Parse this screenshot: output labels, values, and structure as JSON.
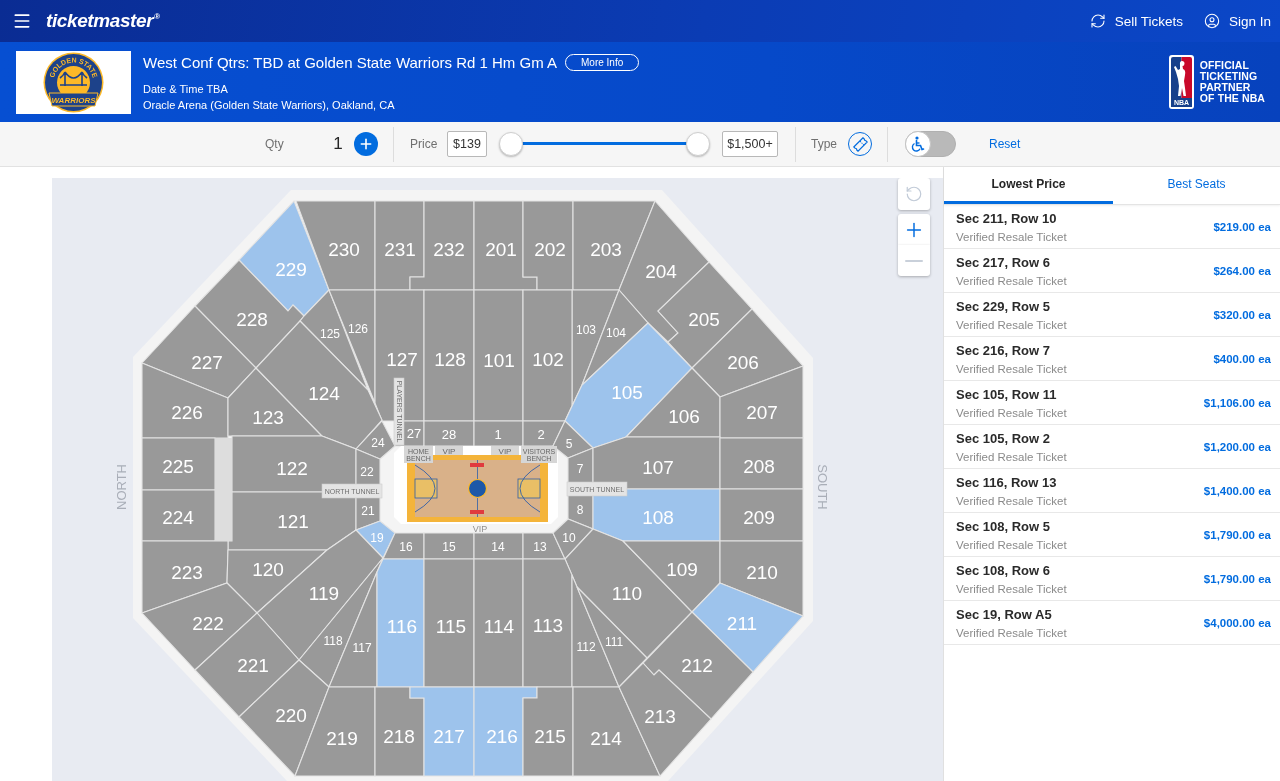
{
  "header": {
    "logo": "ticketmaster",
    "logo_mark": "®",
    "links": [
      {
        "kind": "sell",
        "label": "Sell Tickets"
      },
      {
        "kind": "account",
        "label": "Sign In"
      }
    ]
  },
  "event": {
    "team_logo": {
      "top_text": "GOLDEN STATE",
      "bottom_text": "WARRIORS"
    },
    "title": "West Conf Qtrs: TBD at Golden State Warriors Rd 1 Hm Gm A",
    "more_info": "More Info",
    "date": "Date & Time TBA",
    "venue": "Oracle Arena (Golden State Warriors), Oakland, CA",
    "partner": {
      "logo_text": "NBA",
      "lines": [
        "OFFICIAL",
        "TICKETING",
        "PARTNER",
        "OF THE NBA"
      ]
    }
  },
  "filters": {
    "quantity": {
      "label": "Qty",
      "value": "1"
    },
    "price": {
      "label": "Price",
      "min": "$139",
      "max": "$1,500+",
      "low": {
        "level": 0
      },
      "high": {
        "level": 1
      }
    },
    "type": {
      "label": "Type"
    },
    "accessible": {
      "on": false
    },
    "reset": "Reset"
  },
  "map": {
    "compass": {
      "north": "NORTH",
      "south": "SOUTH"
    },
    "tunnels": {
      "north": "NORTH TUNNEL",
      "south": "SOUTH TUNNEL",
      "players": "PLAYERS TUNNEL"
    },
    "courtside_labels": [
      "HOME BENCH",
      "VIP",
      "VIP",
      "VISITORS BENCH"
    ],
    "baseline_label": "VIP",
    "sections": [
      {
        "label": "229",
        "available": true
      },
      {
        "label": "230",
        "available": false
      },
      {
        "label": "231",
        "available": false
      },
      {
        "label": "232",
        "available": false
      },
      {
        "label": "201",
        "available": false
      },
      {
        "label": "202",
        "available": false
      },
      {
        "label": "203",
        "available": false
      },
      {
        "label": "204",
        "available": false
      },
      {
        "label": "228",
        "available": false
      },
      {
        "label": "125",
        "available": false
      },
      {
        "label": "126",
        "available": false
      },
      {
        "label": "103",
        "available": false
      },
      {
        "label": "104",
        "available": false
      },
      {
        "label": "205",
        "available": false
      },
      {
        "label": "227",
        "available": false
      },
      {
        "label": "127",
        "available": false
      },
      {
        "label": "128",
        "available": false
      },
      {
        "label": "101",
        "available": false
      },
      {
        "label": "102",
        "available": false
      },
      {
        "label": "206",
        "available": false
      },
      {
        "label": "226",
        "available": false
      },
      {
        "label": "123",
        "available": false
      },
      {
        "label": "124",
        "available": false
      },
      {
        "label": "105",
        "available": true
      },
      {
        "label": "106",
        "available": false
      },
      {
        "label": "207",
        "available": false
      },
      {
        "label": "24",
        "available": false
      },
      {
        "label": "27",
        "available": false
      },
      {
        "label": "28",
        "available": false
      },
      {
        "label": "1",
        "available": false
      },
      {
        "label": "2",
        "available": false
      },
      {
        "label": "5",
        "available": false
      },
      {
        "label": "225",
        "available": false
      },
      {
        "label": "122",
        "available": false
      },
      {
        "label": "22",
        "available": false
      },
      {
        "label": "7",
        "available": false
      },
      {
        "label": "107",
        "available": false
      },
      {
        "label": "208",
        "available": false
      },
      {
        "label": "224",
        "available": false
      },
      {
        "label": "121",
        "available": false
      },
      {
        "label": "21",
        "available": false
      },
      {
        "label": "8",
        "available": false
      },
      {
        "label": "108",
        "available": true
      },
      {
        "label": "209",
        "available": false
      },
      {
        "label": "19",
        "available": true
      },
      {
        "label": "16",
        "available": false
      },
      {
        "label": "15",
        "available": false
      },
      {
        "label": "14",
        "available": false
      },
      {
        "label": "13",
        "available": false
      },
      {
        "label": "10",
        "available": false
      },
      {
        "label": "223",
        "available": false
      },
      {
        "label": "120",
        "available": false
      },
      {
        "label": "119",
        "available": false
      },
      {
        "label": "110",
        "available": false
      },
      {
        "label": "109",
        "available": false
      },
      {
        "label": "210",
        "available": false
      },
      {
        "label": "222",
        "available": false
      },
      {
        "label": "118",
        "available": false
      },
      {
        "label": "117",
        "available": false
      },
      {
        "label": "116",
        "available": true
      },
      {
        "label": "115",
        "available": false
      },
      {
        "label": "114",
        "available": false
      },
      {
        "label": "113",
        "available": false
      },
      {
        "label": "112",
        "available": false
      },
      {
        "label": "111",
        "available": false
      },
      {
        "label": "211",
        "available": true
      },
      {
        "label": "221",
        "available": false
      },
      {
        "label": "212",
        "available": false
      },
      {
        "label": "220",
        "available": false
      },
      {
        "label": "219",
        "available": false
      },
      {
        "label": "218",
        "available": false
      },
      {
        "label": "217",
        "available": true
      },
      {
        "label": "216",
        "available": true
      },
      {
        "label": "215",
        "available": false
      },
      {
        "label": "214",
        "available": false
      },
      {
        "label": "213",
        "available": false
      }
    ],
    "controls": {
      "reset_view": {
        "disabled": true
      },
      "zoom_in": {
        "disabled": false
      },
      "zoom_out": {
        "disabled": true
      }
    }
  },
  "sidebar": {
    "tabs": [
      {
        "label": "Lowest Price",
        "selected": true
      },
      {
        "label": "Best Seats",
        "selected": false
      }
    ],
    "listings": [
      {
        "title": "Sec 211, Row 10",
        "subtitle": "Verified Resale Ticket",
        "price": "$219.00 ea"
      },
      {
        "title": "Sec 217, Row 6",
        "subtitle": "Verified Resale Ticket",
        "price": "$264.00 ea"
      },
      {
        "title": "Sec 229, Row 5",
        "subtitle": "Verified Resale Ticket",
        "price": "$320.00 ea"
      },
      {
        "title": "Sec 216, Row 7",
        "subtitle": "Verified Resale Ticket",
        "price": "$400.00 ea"
      },
      {
        "title": "Sec 105, Row 11",
        "subtitle": "Verified Resale Ticket",
        "price": "$1,106.00 ea"
      },
      {
        "title": "Sec 105, Row 2",
        "subtitle": "Verified Resale Ticket",
        "price": "$1,200.00 ea"
      },
      {
        "title": "Sec 116, Row 13",
        "subtitle": "Verified Resale Ticket",
        "price": "$1,400.00 ea"
      },
      {
        "title": "Sec 108, Row 5",
        "subtitle": "Verified Resale Ticket",
        "price": "$1,790.00 ea"
      },
      {
        "title": "Sec 108, Row 6",
        "subtitle": "Verified Resale Ticket",
        "price": "$1,790.00 ea"
      },
      {
        "title": "Sec 19, Row A5",
        "subtitle": "Verified Resale Ticket",
        "price": "$4,000.00 ea"
      }
    ]
  }
}
